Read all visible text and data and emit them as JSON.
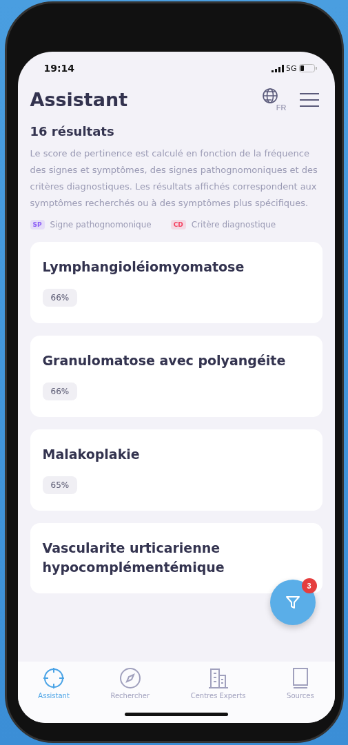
{
  "status_bar": {
    "time": "19:14",
    "network": "5G"
  },
  "header": {
    "title": "Assistant",
    "language": "FR"
  },
  "results": {
    "count": "16 résultats",
    "description": "Le score de pertinence est calculé en fonction de la fréquence des signes et symptômes, des signes pathognomoniques et des critères diagnostiques. Les résultats affichés correspondent aux symptômes recherchés ou à des symptômes plus spécifiques."
  },
  "legend": [
    {
      "tag": "SP",
      "label": "Signe pathognomonique",
      "color": "#8b5cf6"
    },
    {
      "tag": "CD",
      "label": "Critère diagnostique",
      "color": "#f43f5e"
    }
  ],
  "cards": [
    {
      "title": "Lymphangioléiomyomatose",
      "score": "66%"
    },
    {
      "title": "Granulomatose avec polyangéite",
      "score": "66%"
    },
    {
      "title": "Malakoplakie",
      "score": "65%"
    },
    {
      "title": "Vascularite urticarienne hypocomplémentémique"
    }
  ],
  "filter_button": {
    "badge": "3"
  },
  "tab_bar": [
    {
      "label": "Assistant",
      "selected": true
    },
    {
      "label": "Rechercher",
      "selected": false
    },
    {
      "label": "Centres Experts",
      "selected": false
    },
    {
      "label": "Sources",
      "selected": false
    }
  ]
}
